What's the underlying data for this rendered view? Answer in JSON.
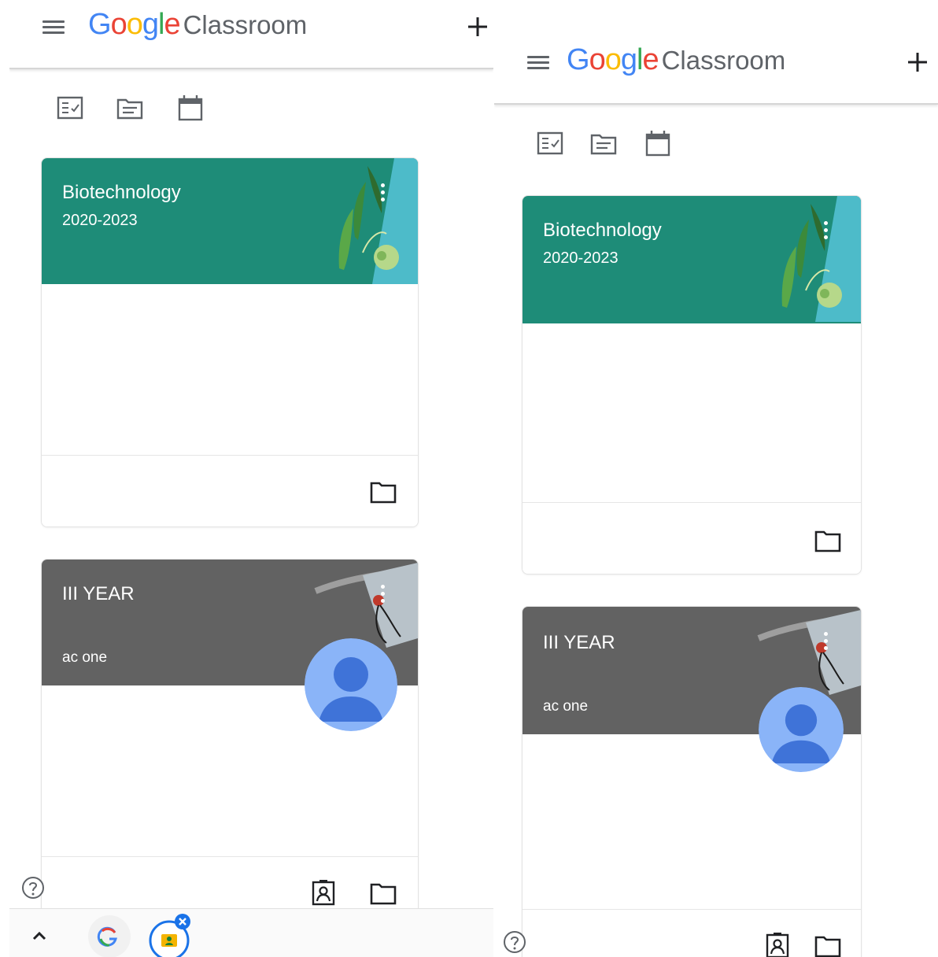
{
  "screens": [
    {
      "header": {
        "logo_google_letters": [
          "G",
          "o",
          "o",
          "g",
          "l",
          "e"
        ],
        "logo_product": "Classroom"
      },
      "toolbar": {
        "icons": [
          "to-do-checklist-icon",
          "to-review-icon",
          "calendar-icon"
        ]
      },
      "classes": [
        {
          "title": "Biotechnology",
          "section": "2020-2023",
          "owner": "",
          "theme": "teal-peas",
          "theme_color": "#1e8c78",
          "footer_icons": [
            "folder-icon"
          ]
        },
        {
          "title": "III YEAR",
          "section": "",
          "owner": "ac one",
          "theme": "grey-microphone",
          "theme_color": "#626262",
          "footer_icons": [
            "assignment-ind-icon",
            "folder-icon"
          ]
        }
      ],
      "bottom_bar": {
        "icons": [
          "chevron-up-icon",
          "google-g-icon",
          "classroom-bubble-icon",
          "close-badge-icon"
        ]
      }
    },
    {
      "header": {
        "logo_google_letters": [
          "G",
          "o",
          "o",
          "g",
          "l",
          "e"
        ],
        "logo_product": "Classroom"
      },
      "toolbar": {
        "icons": [
          "to-do-checklist-icon",
          "to-review-icon",
          "calendar-icon"
        ]
      },
      "classes": [
        {
          "title": "Biotechnology",
          "section": "2020-2023",
          "owner": "",
          "theme": "teal-peas",
          "theme_color": "#1e8c78",
          "footer_icons": [
            "folder-icon"
          ]
        },
        {
          "title": "III YEAR",
          "section": "",
          "owner": "ac one",
          "theme": "grey-microphone",
          "theme_color": "#626262",
          "footer_icons": [
            "assignment-ind-icon",
            "folder-icon"
          ]
        }
      ]
    }
  ],
  "colors": {
    "google_blue": "#4285f4",
    "google_red": "#ea4335",
    "google_yellow": "#fbbc05",
    "google_green": "#34a853",
    "text_grey": "#5f6368",
    "teal_banner": "#1e8c78",
    "grey_banner": "#626262"
  }
}
